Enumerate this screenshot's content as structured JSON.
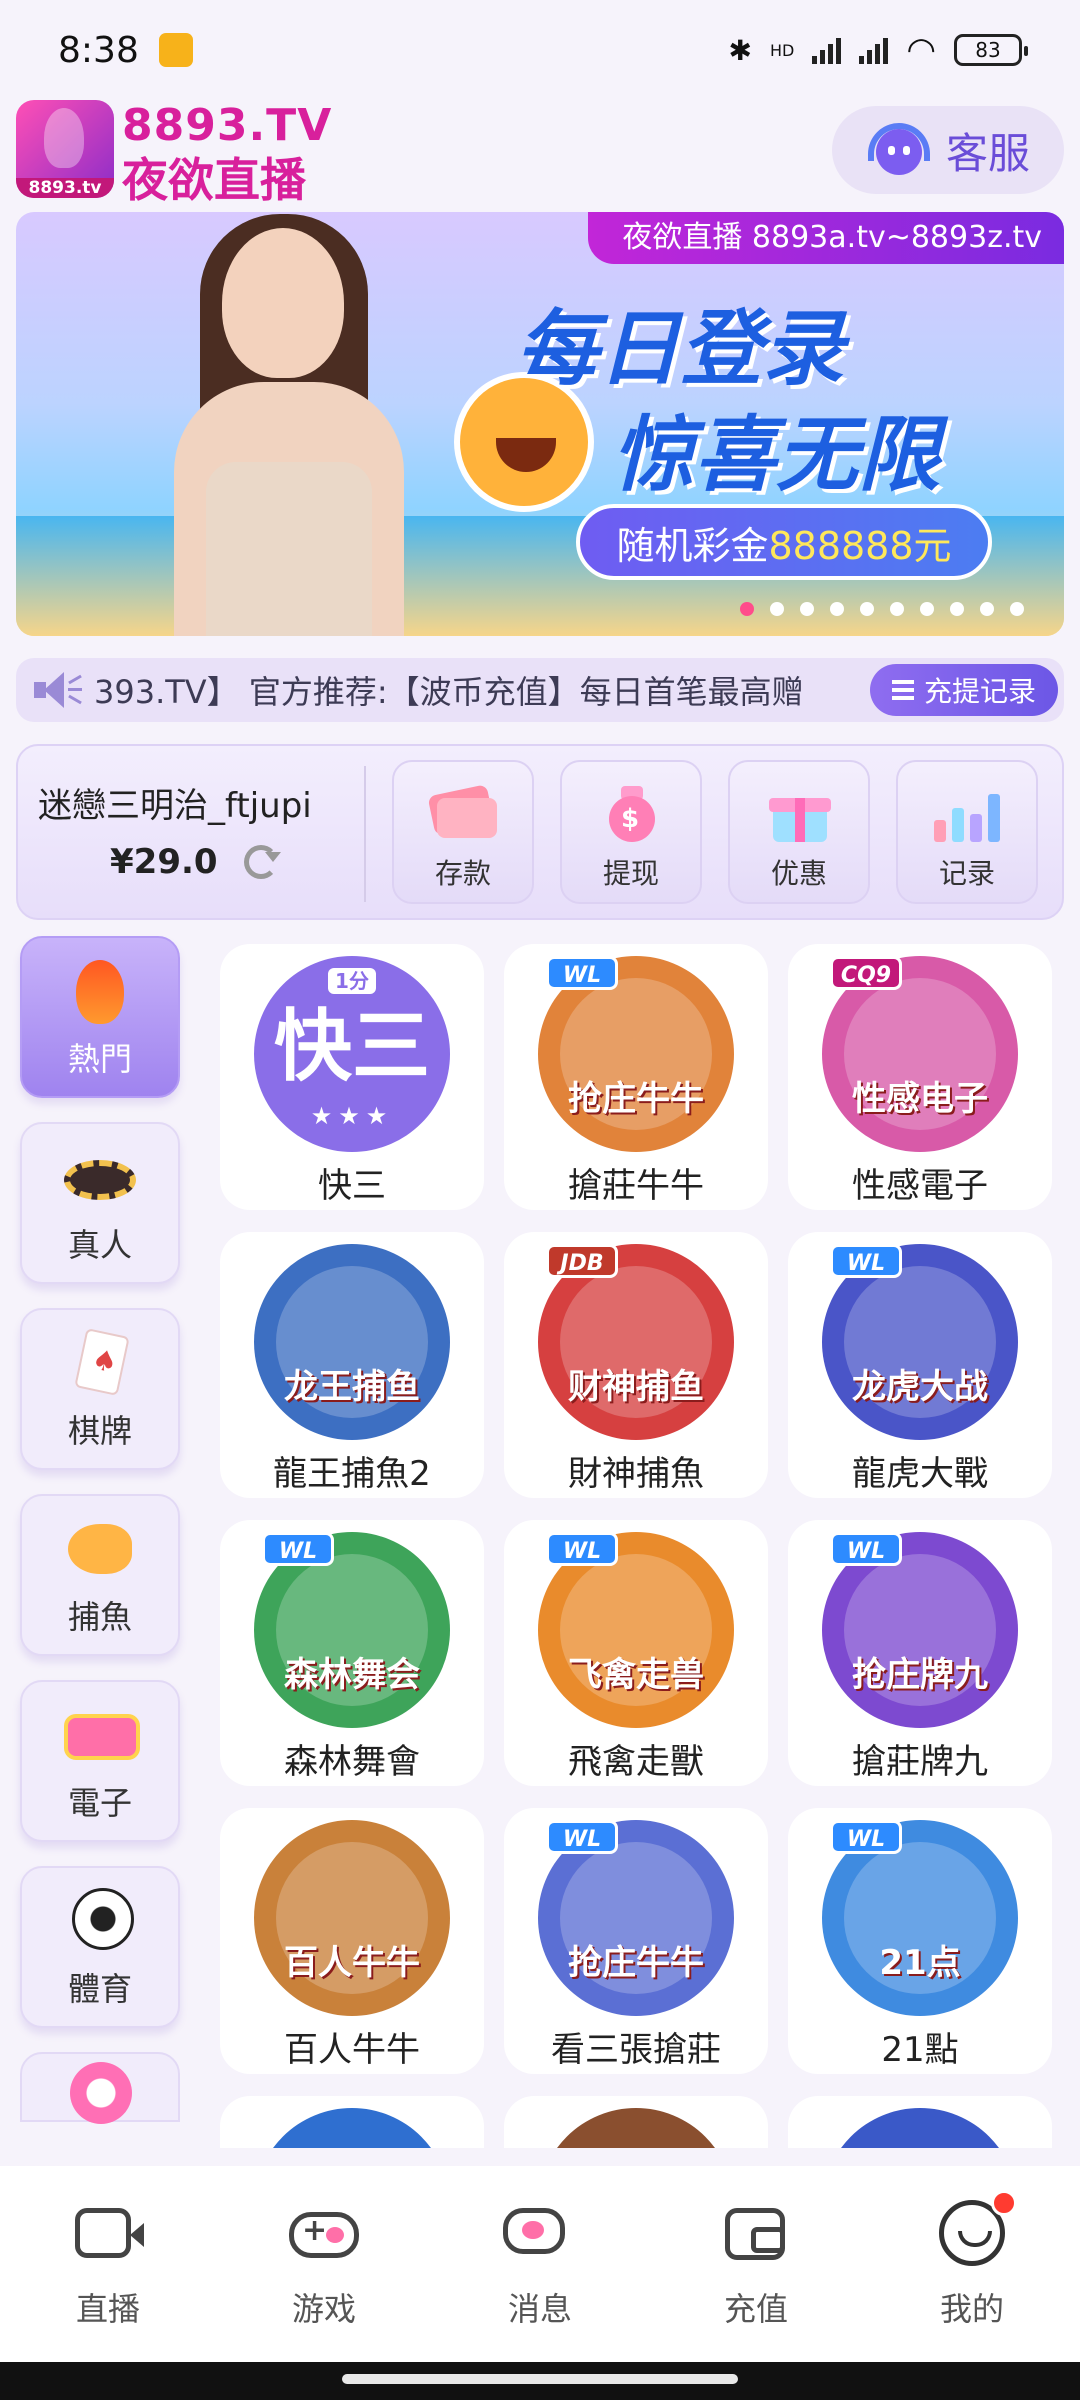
{
  "status_bar": {
    "time": "8:38",
    "hd_label": "HD",
    "battery": "83"
  },
  "header": {
    "logo_tag": "8893.tv",
    "logo_line1": "8893.TV",
    "logo_line2": "夜欲直播",
    "service_label": "客服"
  },
  "banner": {
    "tag": "夜欲直播 8893a.tv~8893z.tv",
    "title1": "每日登录",
    "title2": "惊喜无限",
    "prize_prefix": "随机彩金",
    "prize_amount": "888888元"
  },
  "marquee": {
    "text": "393.TV】 官方推荐:【波币充值】每日首笔最高赠",
    "record_label": "充提记录"
  },
  "account": {
    "username": "迷戀三明治_ftjupi",
    "balance": "¥29.0",
    "actions": [
      {
        "label": "存款",
        "icon": "card-icon"
      },
      {
        "label": "提现",
        "icon": "money-bag-icon"
      },
      {
        "label": "优惠",
        "icon": "gift-icon"
      },
      {
        "label": "记录",
        "icon": "chart-icon"
      }
    ]
  },
  "categories": [
    {
      "label": "熱門",
      "active": true
    },
    {
      "label": "真人",
      "active": false
    },
    {
      "label": "棋牌",
      "active": false
    },
    {
      "label": "捕魚",
      "active": false
    },
    {
      "label": "電子",
      "active": false
    },
    {
      "label": "體育",
      "active": false
    }
  ],
  "games": [
    {
      "label": "快三",
      "art_text": "快三",
      "badge": "1分",
      "color": "#8a6ee8"
    },
    {
      "label": "搶莊牛牛",
      "art_text": "抢庄牛牛",
      "badge": "WL",
      "color": "#e1833a"
    },
    {
      "label": "性感電子",
      "art_text": "性感电子",
      "badge": "CQ9",
      "color": "#d85aa8"
    },
    {
      "label": "龍王捕魚2",
      "art_text": "龙王捕鱼",
      "badge": "",
      "color": "#3d6fc2"
    },
    {
      "label": "財神捕魚",
      "art_text": "财神捕鱼",
      "badge": "JDB",
      "color": "#d64040"
    },
    {
      "label": "龍虎大戰",
      "art_text": "龙虎大战",
      "badge": "WL",
      "color": "#4a55c8"
    },
    {
      "label": "森林舞會",
      "art_text": "森林舞会",
      "badge": "WL",
      "color": "#3ea45a"
    },
    {
      "label": "飛禽走獸",
      "art_text": "飞禽走兽",
      "badge": "WL",
      "color": "#e98b2c"
    },
    {
      "label": "搶莊牌九",
      "art_text": "抢庄牌九",
      "badge": "WL",
      "color": "#7d4ad0"
    },
    {
      "label": "百人牛牛",
      "art_text": "百人牛牛",
      "badge": "",
      "color": "#c9813a"
    },
    {
      "label": "看三張搶莊",
      "art_text": "抢庄牛牛",
      "badge": "WL",
      "color": "#5b6fd4"
    },
    {
      "label": "21點",
      "art_text": "21点",
      "badge": "WL",
      "color": "#3f8be0"
    }
  ],
  "bottom_nav": [
    {
      "label": "直播",
      "icon": "live-tv-icon"
    },
    {
      "label": "游戏",
      "icon": "gamepad-icon"
    },
    {
      "label": "消息",
      "icon": "chat-icon"
    },
    {
      "label": "充值",
      "icon": "wallet-icon"
    },
    {
      "label": "我的",
      "icon": "profile-face-icon"
    }
  ],
  "colors": {
    "accent": "#8f6df0",
    "brand_pink": "#d8209c",
    "notification": "#ff3b30"
  }
}
